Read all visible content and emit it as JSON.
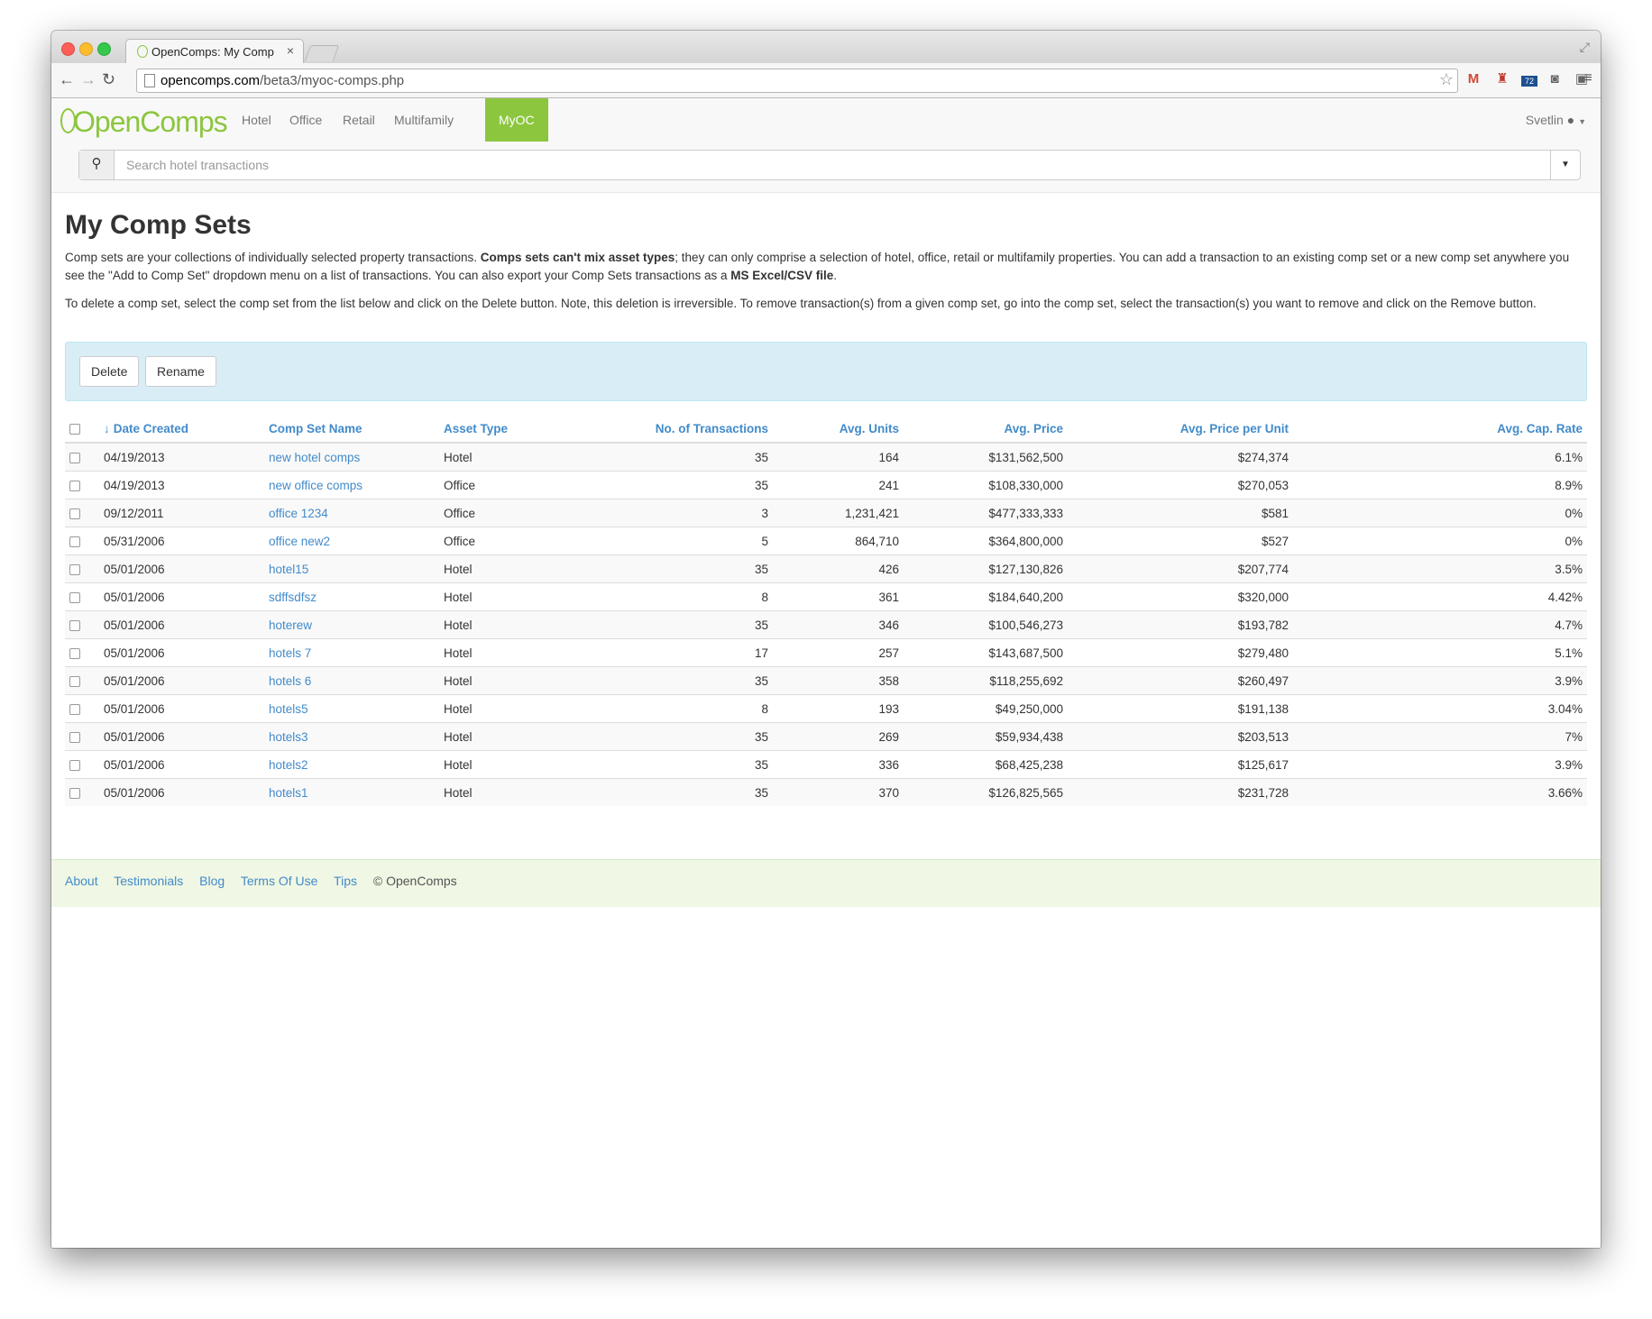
{
  "browser": {
    "tab_title": "OpenComps: My Comp Set",
    "tab_close": "×",
    "url_domain": "opencomps.com",
    "url_path": "/beta3/myoc-comps.php",
    "extension_badge": "72"
  },
  "navbar": {
    "logo": "OpenComps",
    "items": [
      {
        "label": "Hotel"
      },
      {
        "label": "Office"
      },
      {
        "label": "Retail"
      },
      {
        "label": "Multifamily"
      },
      {
        "label": "MyOC"
      }
    ],
    "active_item": "MyOC",
    "user": "Svetlin",
    "search_placeholder": "Search hotel transactions"
  },
  "page": {
    "title": "My Comp Sets",
    "para1_a": "Comp sets are your collections of individually selected property transactions. ",
    "para1_b": "Comps sets can't mix asset types",
    "para1_c": "; they can only comprise a selection of hotel, office, retail or multifamily properties. You can add a transaction to an existing comp set or a new comp set anywhere you see the \"Add to Comp Set\" dropdown menu on a list of transactions. You can also export your Comp Sets transactions as a ",
    "para1_d": "MS Excel/CSV file",
    "para1_e": ".",
    "para2": "To delete a comp set, select the comp set from the list below and click on the Delete button. Note, this deletion is irreversible. To remove transaction(s) from a given comp set, go into the comp set, select the transaction(s) you want to remove and click on the Remove button.",
    "delete_label": "Delete",
    "rename_label": "Rename"
  },
  "table": {
    "sort_indicator": "↓",
    "headers": {
      "date": "Date Created",
      "name": "Comp Set Name",
      "asset": "Asset Type",
      "txns": "No. of Transactions",
      "units": "Avg. Units",
      "price": "Avg. Price",
      "ppu": "Avg. Price per Unit",
      "cap": "Avg. Cap. Rate"
    },
    "rows": [
      {
        "date": "04/19/2013",
        "name": "new hotel comps",
        "asset": "Hotel",
        "txns": "35",
        "units": "164",
        "price": "$131,562,500",
        "ppu": "$274,374",
        "cap": "6.1%"
      },
      {
        "date": "04/19/2013",
        "name": "new office comps",
        "asset": "Office",
        "txns": "35",
        "units": "241",
        "price": "$108,330,000",
        "ppu": "$270,053",
        "cap": "8.9%"
      },
      {
        "date": "09/12/2011",
        "name": "office 1234",
        "asset": "Office",
        "txns": "3",
        "units": "1,231,421",
        "price": "$477,333,333",
        "ppu": "$581",
        "cap": "0%"
      },
      {
        "date": "05/31/2006",
        "name": "office new2",
        "asset": "Office",
        "txns": "5",
        "units": "864,710",
        "price": "$364,800,000",
        "ppu": "$527",
        "cap": "0%"
      },
      {
        "date": "05/01/2006",
        "name": "hotel15",
        "asset": "Hotel",
        "txns": "35",
        "units": "426",
        "price": "$127,130,826",
        "ppu": "$207,774",
        "cap": "3.5%"
      },
      {
        "date": "05/01/2006",
        "name": "sdffsdfsz",
        "asset": "Hotel",
        "txns": "8",
        "units": "361",
        "price": "$184,640,200",
        "ppu": "$320,000",
        "cap": "4.42%"
      },
      {
        "date": "05/01/2006",
        "name": "hoterew",
        "asset": "Hotel",
        "txns": "35",
        "units": "346",
        "price": "$100,546,273",
        "ppu": "$193,782",
        "cap": "4.7%"
      },
      {
        "date": "05/01/2006",
        "name": "hotels 7",
        "asset": "Hotel",
        "txns": "17",
        "units": "257",
        "price": "$143,687,500",
        "ppu": "$279,480",
        "cap": "5.1%"
      },
      {
        "date": "05/01/2006",
        "name": "hotels 6",
        "asset": "Hotel",
        "txns": "35",
        "units": "358",
        "price": "$118,255,692",
        "ppu": "$260,497",
        "cap": "3.9%"
      },
      {
        "date": "05/01/2006",
        "name": "hotels5",
        "asset": "Hotel",
        "txns": "8",
        "units": "193",
        "price": "$49,250,000",
        "ppu": "$191,138",
        "cap": "3.04%"
      },
      {
        "date": "05/01/2006",
        "name": "hotels3",
        "asset": "Hotel",
        "txns": "35",
        "units": "269",
        "price": "$59,934,438",
        "ppu": "$203,513",
        "cap": "7%"
      },
      {
        "date": "05/01/2006",
        "name": "hotels2",
        "asset": "Hotel",
        "txns": "35",
        "units": "336",
        "price": "$68,425,238",
        "ppu": "$125,617",
        "cap": "3.9%"
      },
      {
        "date": "05/01/2006",
        "name": "hotels1",
        "asset": "Hotel",
        "txns": "35",
        "units": "370",
        "price": "$126,825,565",
        "ppu": "$231,728",
        "cap": "3.66%"
      }
    ]
  },
  "footer": {
    "links": [
      "About",
      "Testimonials",
      "Blog",
      "Terms Of Use",
      "Tips"
    ],
    "copyright": "© OpenComps"
  },
  "colors": {
    "brand_green": "#8cc63f",
    "link_blue": "#428bca",
    "well_blue": "#d9edf7",
    "footer_green": "#f0f7e4"
  },
  "icons": [
    "back-arrow-icon",
    "forward-arrow-icon",
    "reload-icon",
    "star-icon",
    "gmail-icon",
    "extension-icon",
    "weather-icon",
    "pocket-icon",
    "reader-icon",
    "menu-icon",
    "search-icon",
    "user-icon",
    "caret-down-icon",
    "sort-down-arrow-icon"
  ]
}
